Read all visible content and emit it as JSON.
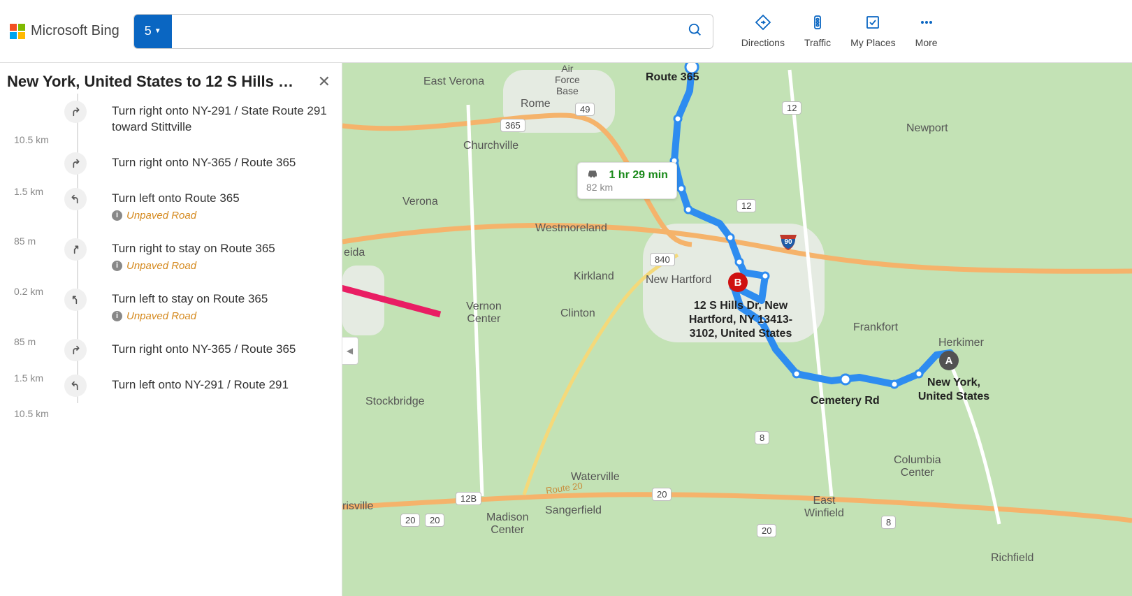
{
  "header": {
    "brand": "Microsoft Bing",
    "search_prefix": "5",
    "search_value": "",
    "nav": {
      "directions": "Directions",
      "traffic": "Traffic",
      "my_places": "My Places",
      "more": "More"
    }
  },
  "panel": {
    "title": "New York, United States to 12 S Hills D…",
    "steps": [
      {
        "icon": "turn-right",
        "text": "Turn right onto NY-291 / State Route 291 toward Stittville",
        "dist_after": "10.5 km"
      },
      {
        "icon": "turn-right",
        "text": "Turn right onto NY-365 / Route 365",
        "dist_after": "1.5 km"
      },
      {
        "icon": "turn-left",
        "text": "Turn left onto Route 365",
        "warning": "Unpaved Road",
        "dist_after": "85 m"
      },
      {
        "icon": "bear-right",
        "text": "Turn right to stay on Route 365",
        "warning": "Unpaved Road",
        "dist_after": "0.2 km"
      },
      {
        "icon": "bear-left",
        "text": "Turn left to stay on Route 365",
        "warning": "Unpaved Road",
        "dist_after": "85 m"
      },
      {
        "icon": "turn-right",
        "text": "Turn right onto NY-365 / Route 365",
        "dist_after": "1.5 km"
      },
      {
        "icon": "turn-left",
        "text": "Turn left onto NY-291 / Route 291",
        "dist_after": "10.5 km"
      }
    ]
  },
  "map": {
    "tooltip": {
      "time": "1 hr 29 min",
      "dist": "82 km"
    },
    "places": {
      "east_verona": "East Verona",
      "rome": "Rome",
      "air_force": "Air\nForce\nBase",
      "churchville": "Churchville",
      "newport": "Newport",
      "verona": "Verona",
      "westmoreland": "Westmoreland",
      "eida": "eida",
      "kirkland": "Kirkland",
      "new_hartford": "New Hartford",
      "vernon_center": "Vernon\nCenter",
      "clinton": "Clinton",
      "frankfort": "Frankfort",
      "herkimer": "Herkimer",
      "stockbridge": "Stockbridge",
      "waterville": "Waterville",
      "sangerfield": "Sangerfield",
      "madison_center": "Madison\nCenter",
      "irisville": "risville",
      "east_winfield": "East\nWinfield",
      "columbia_center": "Columbia\nCenter",
      "richfield": "Richfield"
    },
    "route_labels": {
      "route365": "Route 365",
      "cemetery_rd": "Cemetery Rd"
    },
    "shields": {
      "s365": "365",
      "s49": "49",
      "s12a": "12",
      "s12b": "12",
      "s840": "840",
      "s20a": "20",
      "s20b": "20",
      "s20c": "20",
      "s20d": "20",
      "s12B": "12B",
      "s8a": "8",
      "s8b": "8",
      "sroute20": "Route 20"
    },
    "pins": {
      "a": "A",
      "a_label": "New York,\nUnited States",
      "b": "B",
      "b_label": "12 S Hills Dr, New\nHartford, NY 13413-\n3102, United States"
    }
  }
}
